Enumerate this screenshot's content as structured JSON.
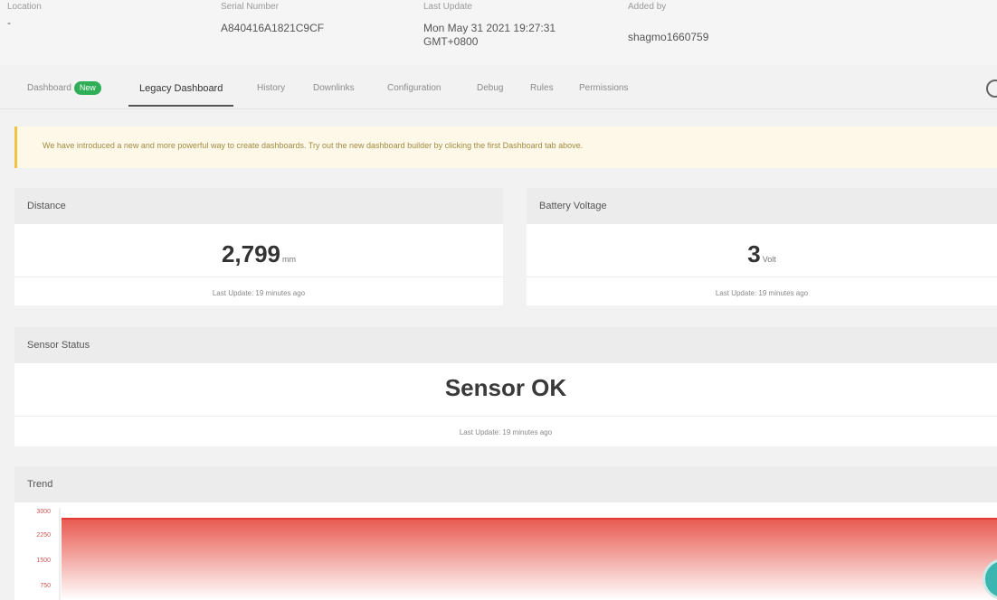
{
  "device_info": {
    "col1": {
      "label": "Location",
      "value": "-"
    },
    "col2": {
      "label": "Serial Number",
      "value": "A840416A1821C9CF"
    },
    "col3": {
      "label": "Last Update",
      "value": "Mon May 31 2021 19:27:31 GMT+0800"
    },
    "col4": {
      "label": "Added by",
      "value": "shagmo1660759"
    }
  },
  "tabs": [
    {
      "label": "Dashboard",
      "badge": "New"
    },
    {
      "label": "Legacy Dashboard"
    },
    {
      "label": "History"
    },
    {
      "label": "Downlinks"
    },
    {
      "label": "Configuration"
    },
    {
      "label": "Debug"
    },
    {
      "label": "Rules"
    },
    {
      "label": "Permissions"
    }
  ],
  "banner": {
    "text": "We have introduced a new and more powerful way to create dashboards. Try out the new dashboard builder by clicking the first Dashboard tab above."
  },
  "cards": {
    "distance": {
      "title": "Distance",
      "value": "2,799",
      "unit": "mm",
      "updated": "Last Update: 19 minutes ago"
    },
    "battery": {
      "title": "Battery Voltage",
      "value": "3",
      "unit": "Volt",
      "updated": "Last Update: 19 minutes ago"
    },
    "sensor": {
      "title": "Sensor Status",
      "value": "Sensor OK",
      "updated": "Last Update: 19 minutes ago"
    }
  },
  "trend": {
    "title": "Trend",
    "ticks": [
      "3000",
      "2250",
      "1500",
      "750"
    ],
    "fill_top_color": "#e8594f",
    "fill_bottom_color": "#ffffff"
  }
}
